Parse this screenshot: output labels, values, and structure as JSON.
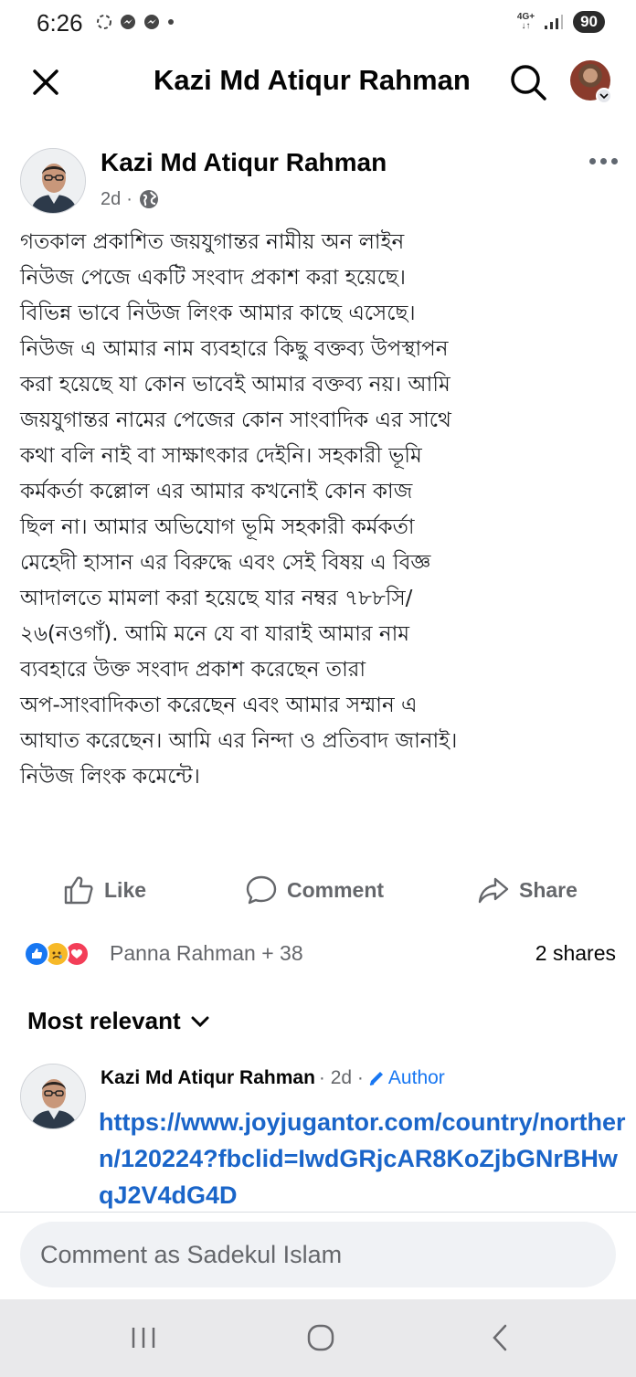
{
  "status_bar": {
    "time": "6:26",
    "network_label": "4G+",
    "battery": "90"
  },
  "topbar": {
    "title": "Kazi Md Atiqur Rahman"
  },
  "post": {
    "author": "Kazi Md Atiqur Rahman",
    "time_ago": "2d",
    "meta_separator": "·",
    "body_lines": [
      "গতকাল প্রকাশিত জয়যুগান্তর নামীয় অন লাইন",
      "নিউজ পেজে একটি সংবাদ প্রকাশ করা হয়েছে।",
      "বিভিন্ন ভাবে নিউজ লিংক আমার কাছে এসেছে।",
      "নিউজ এ আমার নাম ব্যবহারে কিছু বক্তব্য উপস্থাপন",
      "করা হয়েছে যা কোন ভাবেই আমার বক্তব্য নয়। আমি",
      "জয়যুগান্তর নামের পেজের কোন সাংবাদিক এর সাথে",
      "কথা বলি নাই বা সাক্ষাৎকার দেইনি। সহকারী ভূমি",
      "কর্মকর্তা কল্লোল এর আমার কখনোই কোন কাজ",
      "ছিল না। আমার অভিযোগ ভূমি সহকারী কর্মকর্তা",
      "মেহেদী হাসান এর বিরুদ্ধে এবং সেই বিষয় এ বিজ্ঞ",
      "আদালতে মামলা করা হয়েছে যার নম্বর ৭৮৮সি/",
      "২৬(নওগাঁ). আমি মনে যে বা যারাই আমার নাম",
      "ব্যবহারে উক্ত সংবাদ প্রকাশ করেছেন তারা",
      "অপ-সাংবাদিকতা করেছেন এবং আমার সম্মান এ",
      "আঘাত করেছেন। আমি এর নিন্দা ও প্রতিবাদ জানাই।",
      "নিউজ লিংক কমেন্টে।"
    ]
  },
  "actions": {
    "like": "Like",
    "comment": "Comment",
    "share": "Share"
  },
  "engagement": {
    "reaction_summary": "Panna Rahman + 38",
    "shares": "2 shares"
  },
  "comments_section": {
    "sort_label": "Most relevant",
    "comment": {
      "author": "Kazi Md Atiqur Rahman",
      "time_ago": "· 2d ·",
      "badge": "Author",
      "link_text": "https://www.joyjugantor.com/country/northern/120224?fbclid=IwdGRjcAR8KoZjbGNrBHwqJ2V4dG4D"
    },
    "composer_placeholder": "Comment as Sadekul Islam"
  },
  "colors": {
    "link_blue": "#1a65c9",
    "meta_gray": "#65676b",
    "like_blue": "#1877f2",
    "love_red": "#f33e58",
    "sad_yellow": "#f7b928"
  }
}
